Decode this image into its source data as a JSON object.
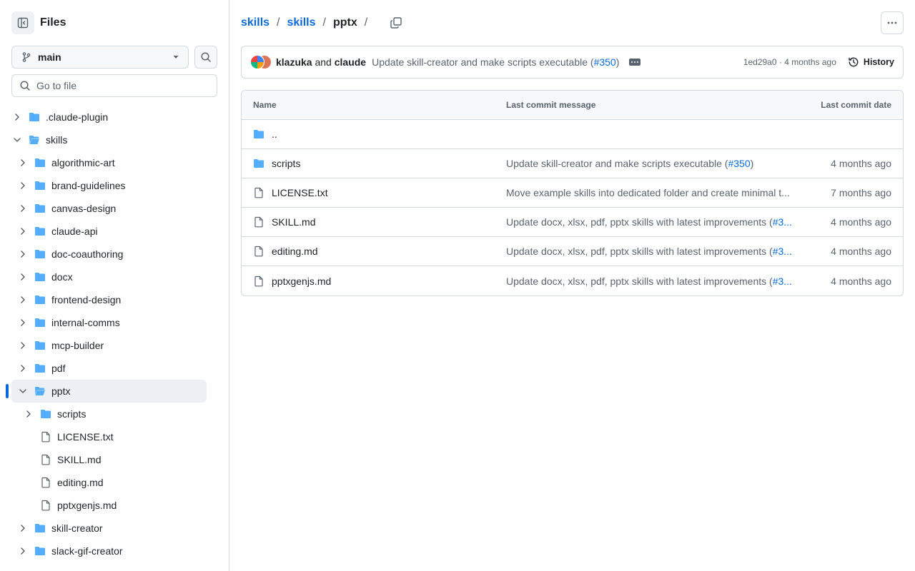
{
  "sidebar": {
    "title": "Files",
    "branch": "main",
    "goto_placeholder": "Go to file",
    "tree": [
      {
        "label": ".claude-plugin",
        "type": "folder",
        "depth": 0,
        "expanded": false
      },
      {
        "label": "skills",
        "type": "folder",
        "depth": 0,
        "expanded": true
      },
      {
        "label": "algorithmic-art",
        "type": "folder",
        "depth": 1,
        "expanded": false
      },
      {
        "label": "brand-guidelines",
        "type": "folder",
        "depth": 1,
        "expanded": false
      },
      {
        "label": "canvas-design",
        "type": "folder",
        "depth": 1,
        "expanded": false
      },
      {
        "label": "claude-api",
        "type": "folder",
        "depth": 1,
        "expanded": false
      },
      {
        "label": "doc-coauthoring",
        "type": "folder",
        "depth": 1,
        "expanded": false
      },
      {
        "label": "docx",
        "type": "folder",
        "depth": 1,
        "expanded": false
      },
      {
        "label": "frontend-design",
        "type": "folder",
        "depth": 1,
        "expanded": false
      },
      {
        "label": "internal-comms",
        "type": "folder",
        "depth": 1,
        "expanded": false
      },
      {
        "label": "mcp-builder",
        "type": "folder",
        "depth": 1,
        "expanded": false
      },
      {
        "label": "pdf",
        "type": "folder",
        "depth": 1,
        "expanded": false
      },
      {
        "label": "pptx",
        "type": "folder",
        "depth": 1,
        "expanded": true,
        "selected": true
      },
      {
        "label": "scripts",
        "type": "folder",
        "depth": 2,
        "expanded": false
      },
      {
        "label": "LICENSE.txt",
        "type": "file",
        "depth": 2
      },
      {
        "label": "SKILL.md",
        "type": "file",
        "depth": 2
      },
      {
        "label": "editing.md",
        "type": "file",
        "depth": 2
      },
      {
        "label": "pptxgenjs.md",
        "type": "file",
        "depth": 2
      },
      {
        "label": "skill-creator",
        "type": "folder",
        "depth": 1,
        "expanded": false
      },
      {
        "label": "slack-gif-creator",
        "type": "folder",
        "depth": 1,
        "expanded": false
      }
    ]
  },
  "breadcrumb": {
    "items": [
      "skills",
      "skills"
    ],
    "current": "pptx",
    "separator": "/"
  },
  "commit": {
    "author1": "klazuka",
    "and": "and",
    "author2": "claude",
    "message": "Update skill-creator and make scripts executable (",
    "pr": "#350",
    "message_end": ")",
    "meta": "1ed29a0 · 4 months ago",
    "history_label": "History"
  },
  "table": {
    "headers": {
      "name": "Name",
      "message": "Last commit message",
      "date": "Last commit date"
    },
    "parent": "..",
    "rows": [
      {
        "name": "scripts",
        "type": "folder",
        "message": "Update skill-creator and make scripts executable (",
        "pr": "#350",
        "message_end": ")",
        "date": "4 months ago"
      },
      {
        "name": "LICENSE.txt",
        "type": "file",
        "message": "Move example skills into dedicated folder and create minimal t...",
        "pr": "",
        "message_end": "",
        "date": "7 months ago"
      },
      {
        "name": "SKILL.md",
        "type": "file",
        "message": "Update docx, xlsx, pdf, pptx skills with latest improvements (",
        "pr": "#3...",
        "message_end": "",
        "date": "4 months ago"
      },
      {
        "name": "editing.md",
        "type": "file",
        "message": "Update docx, xlsx, pdf, pptx skills with latest improvements (",
        "pr": "#3...",
        "message_end": "",
        "date": "4 months ago"
      },
      {
        "name": "pptxgenjs.md",
        "type": "file",
        "message": "Update docx, xlsx, pdf, pptx skills with latest improvements (",
        "pr": "#3...",
        "message_end": "",
        "date": "4 months ago"
      }
    ]
  },
  "colors": {
    "accent": "#0969da",
    "folder": "#54aeff",
    "muted": "#59636e",
    "border": "#d1d9e0"
  }
}
